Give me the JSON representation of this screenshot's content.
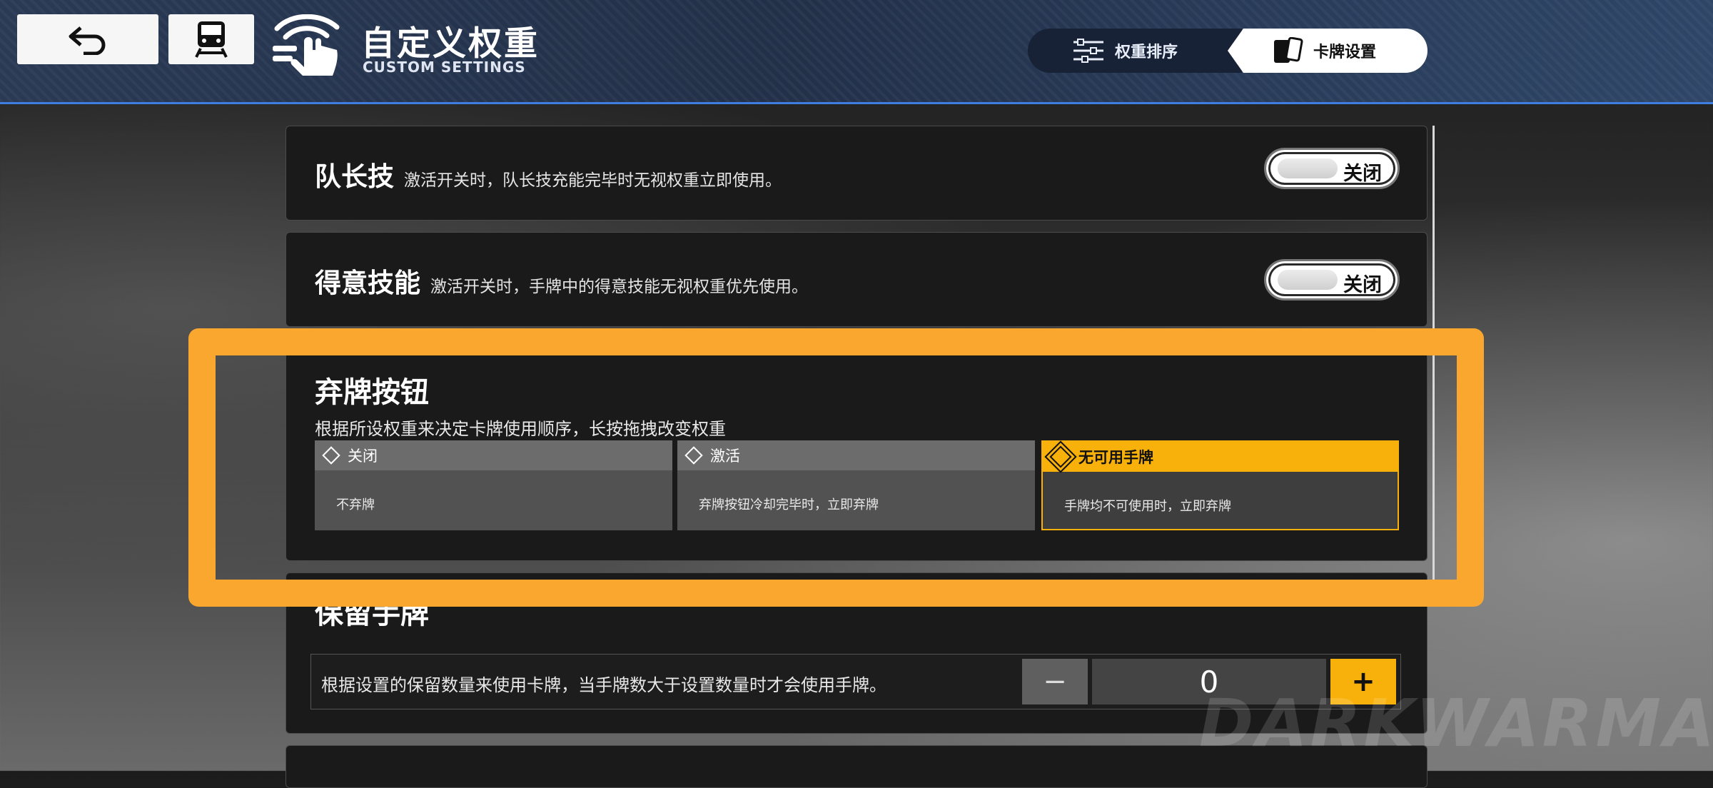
{
  "header": {
    "title": "自定义权重",
    "subtitle": "CUSTOM SETTINGS",
    "tabs": [
      {
        "label": "权重排序",
        "icon": "sliders-icon",
        "active": false
      },
      {
        "label": "卡牌设置",
        "icon": "cards-icon",
        "active": true
      }
    ]
  },
  "captain_skill": {
    "title": "队长技",
    "description": "激活开关时，队长技充能完毕时无视权重立即使用。",
    "toggle_label": "关闭"
  },
  "signature_skill": {
    "title": "得意技能",
    "description": "激活开关时，手牌中的得意技能无视权重优先使用。",
    "toggle_label": "关闭"
  },
  "discard_button": {
    "title": "弃牌按钮",
    "description": "根据所设权重来决定卡牌使用顺序，长按拖拽改变权重",
    "options": [
      {
        "label": "关闭",
        "desc": "不弃牌",
        "selected": false
      },
      {
        "label": "激活",
        "desc": "弃牌按钮冷却完毕时，立即弃牌",
        "selected": false
      },
      {
        "label": "无可用手牌",
        "desc": "手牌均不可使用时，立即弃牌",
        "selected": true
      }
    ]
  },
  "keep_cards": {
    "title": "保留手牌",
    "description": "根据设置的保留数量来使用卡牌，当手牌数大于设置数量时才会使用手牌。",
    "value": "0",
    "minus": "−",
    "plus": "+"
  },
  "watermark": "DARKWARMAMENTS",
  "colors": {
    "accent": "#f8b10a",
    "highlight": "#f9a72e",
    "header": "#223049",
    "header_border": "#3f7de0"
  }
}
